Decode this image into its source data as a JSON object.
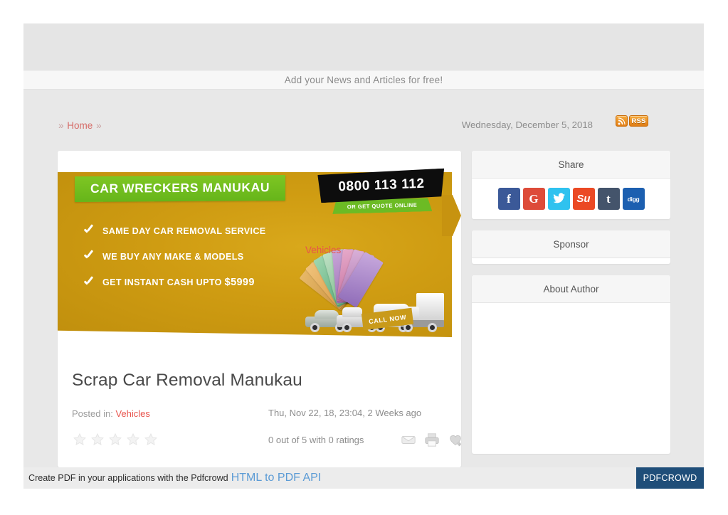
{
  "site": {
    "tagline": "Add your News and Articles for free!"
  },
  "breadcrumb": {
    "sep1": "»",
    "home": "Home",
    "sep2": "»",
    "category": "Vehicles"
  },
  "header": {
    "date": "Wednesday, December 5, 2018",
    "rss_label": "RSS"
  },
  "banner": {
    "title": "CAR WRECKERS MANUKAU",
    "bullets": [
      {
        "text": "SAME DAY CAR REMOVAL SERVICE",
        "highlight": ""
      },
      {
        "text": "WE BUY ANY MAKE & MODELS",
        "highlight": ""
      },
      {
        "text": "GET INSTANT CASH UPTO ",
        "highlight": "$5999"
      }
    ],
    "call_now": "CALL NOW",
    "phone": "0800 113 112",
    "quote_online": "OR GET QUOTE ONLINE"
  },
  "article": {
    "title": "Scrap Car Removal Manukau",
    "posted_in_label": "Posted in:",
    "category": "Vehicles",
    "date": "Thu, Nov 22, 18, 23:04, 2 Weeks ago",
    "rating_text": "0 out of 5 with 0 ratings",
    "stars": 5,
    "actions": [
      {
        "name": "email-icon",
        "label": "Email"
      },
      {
        "name": "print-icon",
        "label": "Print"
      },
      {
        "name": "add-favorite-icon",
        "label": "Add to favorites"
      }
    ]
  },
  "sidebar": {
    "share": {
      "title": "Share",
      "networks": [
        {
          "name": "facebook",
          "glyph": "f",
          "color": "#3b5998"
        },
        {
          "name": "google-plus",
          "glyph": "G",
          "color": "#dd4b39"
        },
        {
          "name": "twitter",
          "glyph": "",
          "color": "#2fc2ef"
        },
        {
          "name": "stumbleupon",
          "glyph": "Su",
          "color": "#eb4924"
        },
        {
          "name": "tumblr",
          "glyph": "t",
          "color": "#44546b"
        },
        {
          "name": "digg",
          "glyph": "digg",
          "color": "#1c5fb0"
        }
      ]
    },
    "sponsor": {
      "title": "Sponsor"
    },
    "about_author": {
      "title": "About Author"
    }
  },
  "footer": {
    "text": "Create PDF in your applications with the Pdfcrowd",
    "link": "HTML to PDF API",
    "logo": "PDFCROWD"
  },
  "colors": {
    "accent_red": "#e8534c",
    "banner_gold": "#cf9c12",
    "banner_green": "#6cbb24",
    "footer_blue": "#1f4e79"
  }
}
